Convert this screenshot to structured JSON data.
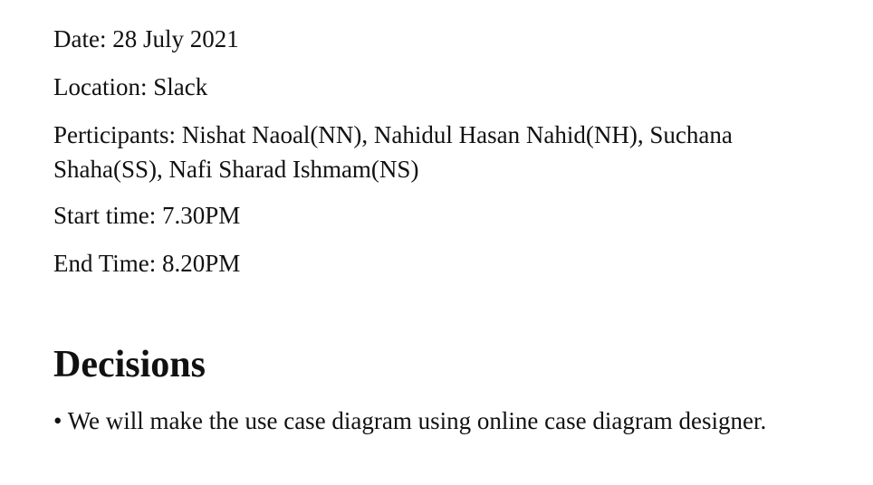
{
  "meeting": {
    "date": "Date: 28 July 2021",
    "location": "Location: Slack",
    "participants": "Perticipants: Nishat Naoal(NN), Nahidul Hasan Nahid(NH), Suchana Shaha(SS), Nafi Sharad Ishmam(NS)",
    "start_time": "Start time: 7.30PM",
    "end_time": "End Time: 8.20PM"
  },
  "decisions": {
    "heading": "Decisions",
    "items": [
      "• We will make the use case diagram using online case diagram designer."
    ]
  }
}
